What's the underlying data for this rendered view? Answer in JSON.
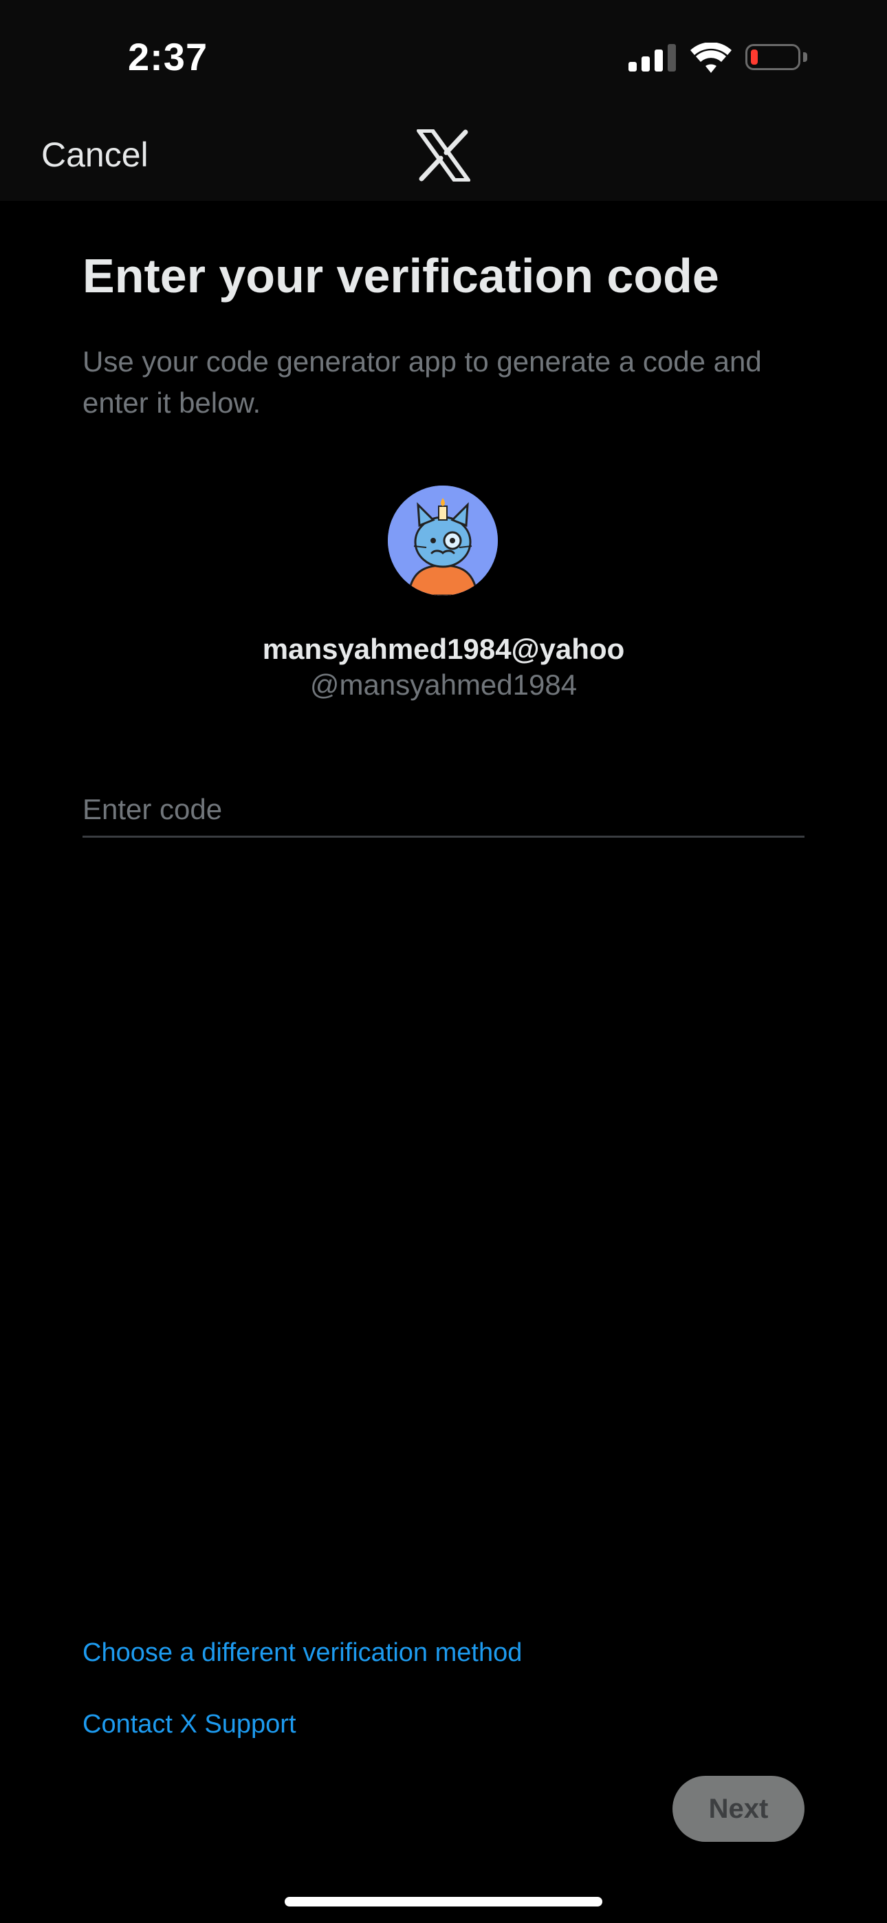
{
  "status_bar": {
    "time": "2:37",
    "battery_level": 0.1,
    "battery_color": "#ff3b30",
    "icons": [
      "cellular-signal-icon",
      "wifi-icon",
      "battery-icon"
    ]
  },
  "nav": {
    "cancel_label": "Cancel",
    "logo": "x-logo-icon"
  },
  "content": {
    "title": "Enter your verification code",
    "subtitle": "Use your code generator app to generate a code and enter it below.",
    "account": {
      "display_name": "mansyahmed1984@yahoo",
      "handle": "@mansyahmed1984"
    },
    "code_field": {
      "value": "",
      "placeholder": "Enter code"
    }
  },
  "links": {
    "different_method": "Choose a different verification method",
    "support": "Contact X Support"
  },
  "actions": {
    "next_label": "Next"
  },
  "colors": {
    "background": "#000000",
    "link": "#1d9bf0",
    "secondary_text": "#71767b",
    "next_button_disabled": "#787a7a"
  }
}
